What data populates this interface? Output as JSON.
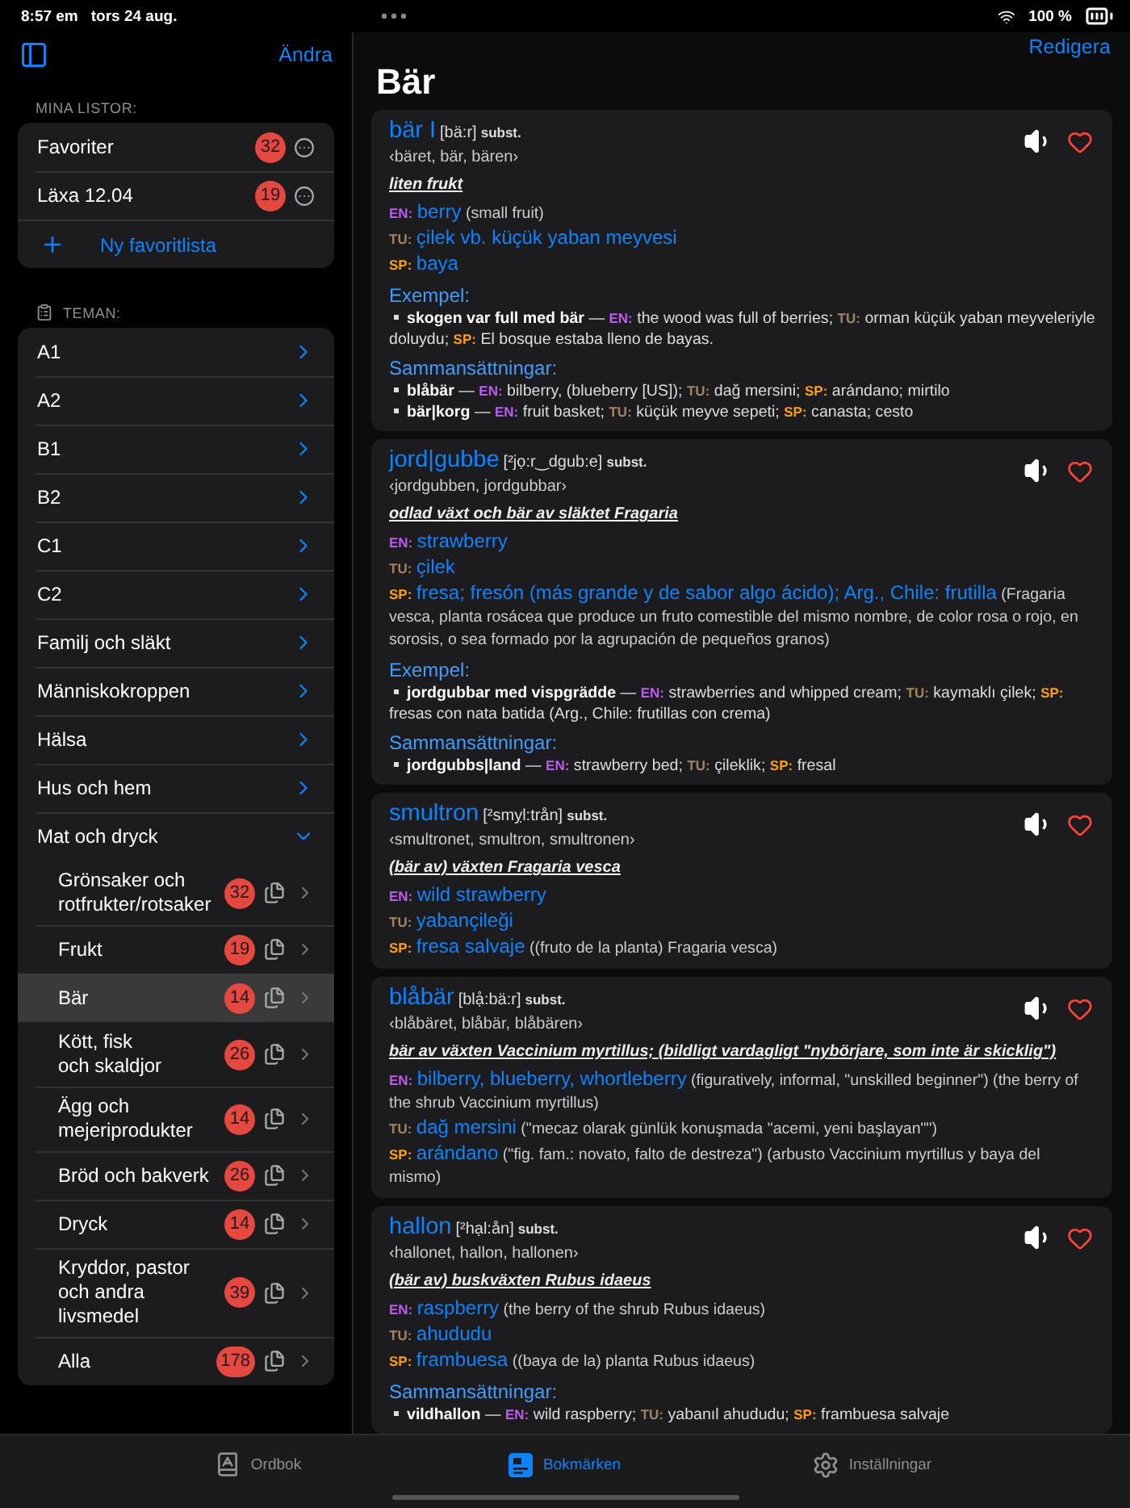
{
  "status_bar": {
    "time": "8:57 em",
    "date": "tors 24 aug.",
    "battery": "100 %"
  },
  "sidebar": {
    "edit_button": "Ändra",
    "lists_heading": "MINA LISTOR:",
    "lists": [
      {
        "label": "Favoriter",
        "count": "32"
      },
      {
        "label": "Läxa 12.04",
        "count": "19"
      }
    ],
    "new_list": "Ny favoritlista",
    "topics_heading": "TEMAN:",
    "topics": [
      {
        "label": "A1",
        "expanded": false
      },
      {
        "label": "A2",
        "expanded": false
      },
      {
        "label": "B1",
        "expanded": false
      },
      {
        "label": "B2",
        "expanded": false
      },
      {
        "label": "C1",
        "expanded": false
      },
      {
        "label": "C2",
        "expanded": false
      },
      {
        "label": "Familj och släkt",
        "expanded": false
      },
      {
        "label": "Människokroppen",
        "expanded": false
      },
      {
        "label": "Hälsa",
        "expanded": false
      },
      {
        "label": "Hus och hem",
        "expanded": false
      },
      {
        "label": "Mat och dryck",
        "expanded": true,
        "children": [
          {
            "label": "Grönsaker och rotfrukter/rotsaker",
            "count": "32",
            "selected": false
          },
          {
            "label": "Frukt",
            "count": "19",
            "selected": false
          },
          {
            "label": "Bär",
            "count": "14",
            "selected": true
          },
          {
            "label": "Kött, fisk\noch skaldjor",
            "count": "26",
            "selected": false
          },
          {
            "label": "Ägg och\nmejeriprodukter",
            "count": "14",
            "selected": false
          },
          {
            "label": "Bröd och bakverk",
            "count": "26",
            "selected": false
          },
          {
            "label": "Dryck",
            "count": "14",
            "selected": false
          },
          {
            "label": "Kryddor, pastor\noch andra\nlivsmedel",
            "count": "39",
            "selected": false
          },
          {
            "label": "Alla",
            "count": "178",
            "selected": false
          }
        ]
      }
    ]
  },
  "main": {
    "edit_button": "Redigera",
    "title": "Bär",
    "entries": [
      {
        "headword": "bär I",
        "pronunciation": "[bä:r]",
        "pos": "subst.",
        "forms": "‹bäret, bär, bären›",
        "definition": "liten frukt",
        "translations": [
          {
            "kind": "en",
            "label": "EN:",
            "main": "berry",
            "note": "(small fruit)"
          },
          {
            "kind": "tu",
            "label": "TU:",
            "main": "çilek vb. küçük yaban meyvesi"
          },
          {
            "kind": "sp",
            "label": "SP:",
            "main": "baya"
          }
        ],
        "sections": [
          {
            "heading": "Exempel:",
            "items": [
              {
                "phrase": "skogen var full med bär",
                "separator": "—",
                "parts": [
                  {
                    "kind": "en",
                    "label": "EN:",
                    "text": "the wood was full of berries;"
                  },
                  {
                    "kind": "tu",
                    "label": "TU:",
                    "text": "orman küçük yaban meyveleriyle doluydu;"
                  },
                  {
                    "kind": "sp",
                    "label": "SP:",
                    "text": "El bosque estaba lleno de bayas."
                  }
                ]
              }
            ]
          },
          {
            "heading": "Sammansättningar:",
            "items": [
              {
                "phrase": "blåbär",
                "separator": "—",
                "parts": [
                  {
                    "kind": "en",
                    "label": "EN:",
                    "text": "bilberry, (blueberry [US]);"
                  },
                  {
                    "kind": "tu",
                    "label": "TU:",
                    "text": "dağ mersini;"
                  },
                  {
                    "kind": "sp",
                    "label": "SP:",
                    "text": "arándano; mirtilo"
                  }
                ]
              },
              {
                "phrase": "bär|korg",
                "separator": "—",
                "parts": [
                  {
                    "kind": "en",
                    "label": "EN:",
                    "text": "fruit basket;"
                  },
                  {
                    "kind": "tu",
                    "label": "TU:",
                    "text": "küçük meyve sepeti;"
                  },
                  {
                    "kind": "sp",
                    "label": "SP:",
                    "text": "canasta; cesto"
                  }
                ]
              }
            ]
          }
        ]
      },
      {
        "headword": "jord|gubbe",
        "pronunciation": "[²jọ:r‿dgub:e]",
        "pos": "subst.",
        "forms": "‹jordgubben, jordgubbar›",
        "definition": "odlad växt och bär av släktet Fragaria",
        "translations": [
          {
            "kind": "en",
            "label": "EN:",
            "main": "strawberry"
          },
          {
            "kind": "tu",
            "label": "TU:",
            "main": "çilek"
          },
          {
            "kind": "sp",
            "label": "SP:",
            "main": "fresa; fresón (más grande y de sabor algo ácido); Arg., Chile: frutilla",
            "note": "(Fragaria vesca, planta rosácea que produce un fruto comestible del mismo nombre, de color rosa o rojo, en sorosis, o sea formado por la agrupación de pequeños granos)"
          }
        ],
        "sections": [
          {
            "heading": "Exempel:",
            "items": [
              {
                "phrase": "jordgubbar med vispgrädde",
                "separator": "—",
                "parts": [
                  {
                    "kind": "en",
                    "label": "EN:",
                    "text": "strawberries and whipped cream;"
                  },
                  {
                    "kind": "tu",
                    "label": "TU:",
                    "text": "kaymaklı çilek;"
                  },
                  {
                    "kind": "sp",
                    "label": "SP:",
                    "text": "fresas con nata batida (Arg., Chile: frutillas con crema)"
                  }
                ]
              }
            ]
          },
          {
            "heading": "Sammansättningar:",
            "items": [
              {
                "phrase": "jordgubbs|land",
                "separator": "—",
                "parts": [
                  {
                    "kind": "en",
                    "label": "EN:",
                    "text": "strawberry bed;"
                  },
                  {
                    "kind": "tu",
                    "label": "TU:",
                    "text": "çileklik;"
                  },
                  {
                    "kind": "sp",
                    "label": "SP:",
                    "text": "fresal"
                  }
                ]
              }
            ]
          }
        ]
      },
      {
        "headword": "smultron",
        "pronunciation": "[²smỵl:trån]",
        "pos": "subst.",
        "forms": "‹smultronet, smultron, smultronen›",
        "definition": "(bär av) växten Fragaria vesca",
        "translations": [
          {
            "kind": "en",
            "label": "EN:",
            "main": "wild strawberry"
          },
          {
            "kind": "tu",
            "label": "TU:",
            "main": "yabançileği"
          },
          {
            "kind": "sp",
            "label": "SP:",
            "main": "fresa salvaje",
            "note": "((fruto de la planta) Fragaria vesca)"
          }
        ]
      },
      {
        "headword": "blåbär",
        "pronunciation": "[blạ̊:bä:r]",
        "pos": "subst.",
        "forms": "‹blåbäret, blåbär, blåbären›",
        "definition": "bär av växten Vaccinium myrtillus; (bildligt vardagligt \"nybörjare, som inte är skicklig\")",
        "translations": [
          {
            "kind": "en",
            "label": "EN:",
            "main": "bilberry, blueberry, whortleberry",
            "note": "(figuratively, informal, \"unskilled beginner\") (the berry of the shrub Vaccinium myrtillus)"
          },
          {
            "kind": "tu",
            "label": "TU:",
            "main": "dağ mersini",
            "note": "(\"mecaz olarak günlük konuşmada \"acemi, yeni başlayan\"\")"
          },
          {
            "kind": "sp",
            "label": "SP:",
            "main": "arándano",
            "note": "(\"fig. fam.: novato, falto de destreza\") (arbusto Vaccinium myrtillus y baya del mismo)"
          }
        ]
      },
      {
        "headword": "hallon",
        "pronunciation": "[²hạl:ån]",
        "pos": "subst.",
        "forms": "‹hallonet, hallon, hallonen›",
        "definition": "(bär av) buskväxten Rubus idaeus",
        "translations": [
          {
            "kind": "en",
            "label": "EN:",
            "main": "raspberry",
            "note": "(the berry of the shrub Rubus idaeus)"
          },
          {
            "kind": "tu",
            "label": "TU:",
            "main": "ahududu"
          },
          {
            "kind": "sp",
            "label": "SP:",
            "main": "frambuesa",
            "note": "((baya de la) planta Rubus idaeus)"
          }
        ],
        "sections": [
          {
            "heading": "Sammansättningar:",
            "items": [
              {
                "phrase": "vildhallon",
                "separator": "—",
                "parts": [
                  {
                    "kind": "en",
                    "label": "EN:",
                    "text": "wild raspberry;"
                  },
                  {
                    "kind": "tu",
                    "label": "TU:",
                    "text": "yabanıl ahududu;"
                  },
                  {
                    "kind": "sp",
                    "label": "SP:",
                    "text": "frambuesa salvaje"
                  }
                ]
              }
            ]
          }
        ]
      }
    ]
  },
  "tab_bar": [
    {
      "kind": "dictionary",
      "label": "Ordbok",
      "selected": false
    },
    {
      "kind": "bookmarks",
      "label": "Bokmärken",
      "selected": true
    },
    {
      "kind": "settings",
      "label": "Inställningar",
      "selected": false
    }
  ]
}
